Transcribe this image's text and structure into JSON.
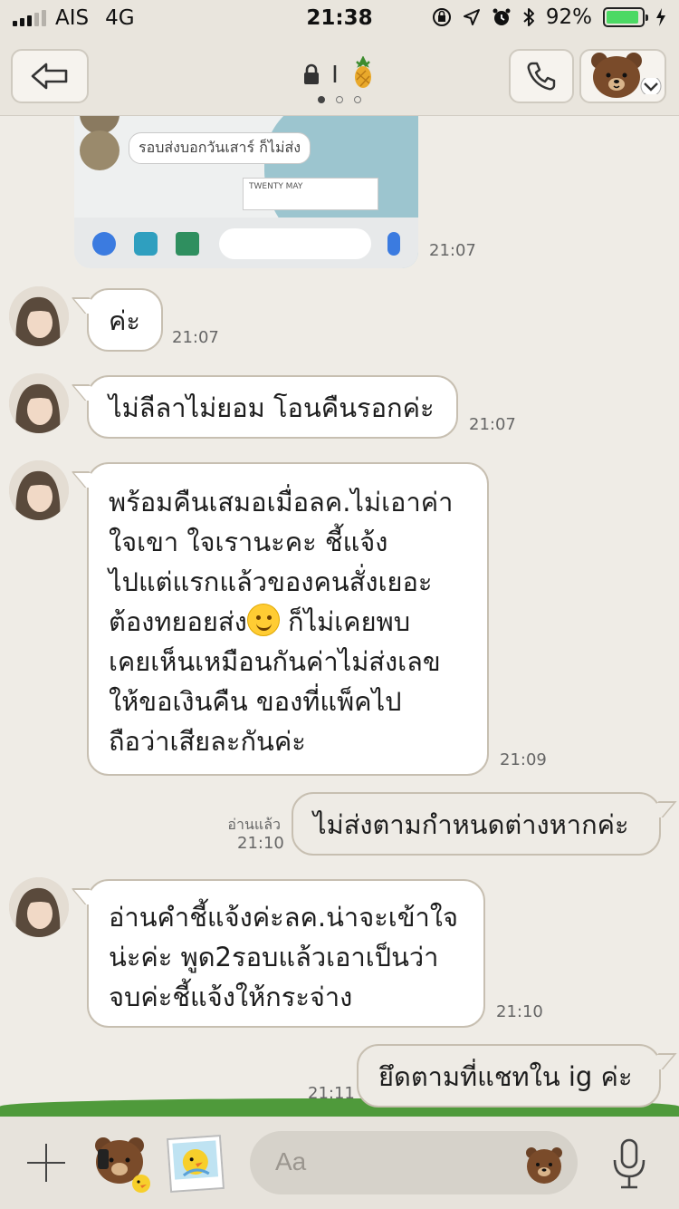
{
  "status_bar": {
    "carrier": "AIS",
    "network": "4G",
    "time": "21:38",
    "battery_percent": "92%",
    "battery_level": 0.92
  },
  "header": {
    "title_text": "I",
    "page_count": 3,
    "active_page": 1
  },
  "image_message": {
    "inner_text": "รอบส่งบอกวันเสาร์ ก็ไม่ส่ง",
    "card_text": "TWENTY MAY",
    "time": "21:07"
  },
  "messages": [
    {
      "dir": "in",
      "lines": [
        "ค่ะ"
      ],
      "time": "21:07"
    },
    {
      "dir": "in",
      "lines": [
        "ไม่ลีลาไม่ยอม โอนคืนรอกค่ะ"
      ],
      "time": "21:07"
    },
    {
      "dir": "in",
      "lines": [
        "พร้อมคืนเสมอเมื่อลค.ไม่เอาค่า",
        "ใจเขา ใจเรานะคะ ชี้แจ้ง",
        "ไปแต่แรกแล้วของคนสั่งเยอะ",
        "ต้องทยอยส่ง",
        "เคยเห็นเหมือนกันค่าไม่ส่งเลข",
        "ให้ขอเงินคืน ของที่แพ็คไป",
        "ถือว่าเสียละกันค่ะ"
      ],
      "line4_after_emoji": " ก็ไม่เคยพบ",
      "time": "21:09"
    },
    {
      "dir": "out",
      "lines": [
        "ไม่ส่งตามกำหนดต่างหากค่ะ"
      ],
      "read": "อ่านแล้ว",
      "time": "21:10"
    },
    {
      "dir": "in",
      "lines": [
        "อ่านคำชี้แจ้งค่ะลค.น่าจะเข้าใจ",
        "น่ะค่ะ พูด2รอบแล้วเอาเป็นว่า",
        "จบค่ะชี้แจ้งให้กระจ่าง"
      ],
      "time": "21:10"
    },
    {
      "dir": "out",
      "lines": [
        "ยึดตามที่แชทใน ig ค่ะ"
      ],
      "time": "21:11"
    }
  ],
  "input": {
    "placeholder": "Aa"
  },
  "icons": {
    "back": "back-arrow-icon",
    "call": "phone-icon",
    "profile": "brown-bear-icon",
    "title_lock": "lock-icon",
    "title_fruit": "pineapple-icon",
    "plus": "plus-icon",
    "sticker": "sticker-icon",
    "photo_sticker": "photo-sticker-icon",
    "emoji": "emoji-bear-icon",
    "mic": "microphone-icon"
  },
  "colors": {
    "background": "#efece6",
    "bubble_border": "#c7bfb1",
    "battery": "#4cd964",
    "accent_green": "#4f9a3b"
  }
}
